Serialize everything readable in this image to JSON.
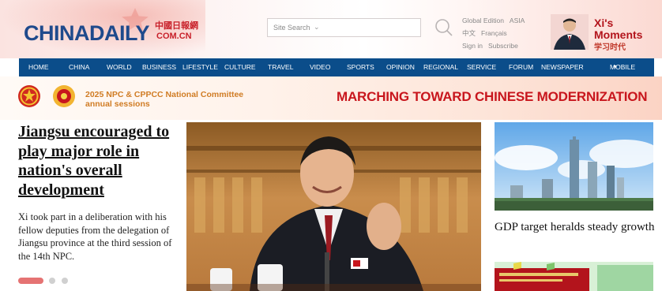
{
  "header": {
    "logo_text": "CHINADAILY",
    "logo_cn": "中國日報網",
    "logo_domain": "COM.CN",
    "search_placeholder": "Site Search",
    "search_caret": "⌄",
    "editions": [
      "Global Edition",
      "ASIA"
    ],
    "languages": [
      "中文",
      "Français"
    ],
    "account": [
      "Sign in",
      "Subscribe"
    ],
    "xi_title_1": "Xi's",
    "xi_title_2": "Moments",
    "xi_cn": "学习时代"
  },
  "nav": {
    "items": [
      "HOME",
      "CHINA",
      "WORLD",
      "BUSINESS",
      "LIFESTYLE",
      "CULTURE",
      "TRAVEL",
      "VIDEO",
      "SPORTS",
      "OPINION",
      "REGIONAL",
      "SERVICE",
      "FORUM",
      "NEWSPAPER",
      "MOBILE"
    ],
    "dropdown_caret": "▼"
  },
  "banner": {
    "npc_line1": "2025 NPC & CPPCC National Committee",
    "npc_line2": "annual sessions",
    "slogan": "MARCHING TOWARD CHINESE MODERNIZATION"
  },
  "featured": {
    "headline": "Jiangsu encouraged to play major role in nation's overall development",
    "summary": "Xi took part in a deliberation with his fellow deputies from the delegation of Jiangsu province at the third session of the 14th NPC.",
    "slide_count": 3,
    "active_slide": 1
  },
  "side": {
    "title": "GDP target heralds steady growth"
  },
  "colors": {
    "nav_bg": "#0b4d8a",
    "logo_blue": "#1f4a8c",
    "accent_red": "#c8161d",
    "npc_orange": "#d07c24",
    "active_dot": "#e57373"
  }
}
